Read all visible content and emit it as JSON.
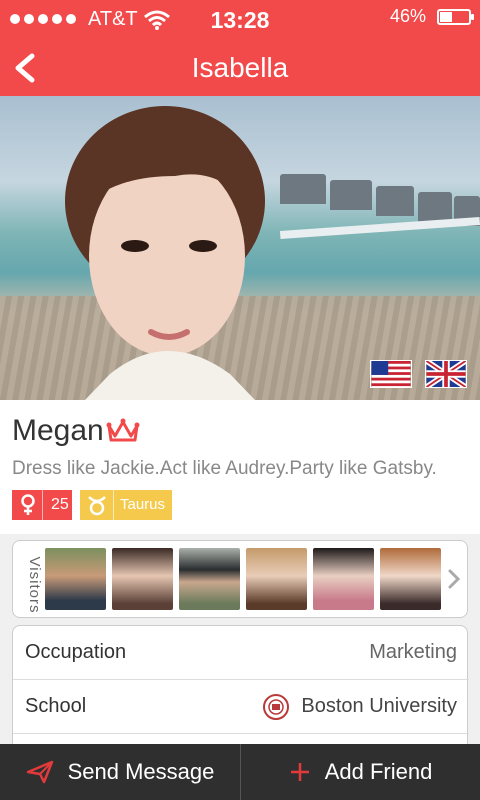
{
  "status_bar": {
    "carrier": "AT&T",
    "time": "13:28",
    "battery": "46%"
  },
  "nav": {
    "title": "Isabella",
    "back_icon": "chevron-left-icon"
  },
  "photo": {
    "flags": [
      "us-flag",
      "uk-flag"
    ]
  },
  "profile": {
    "name": "Megan",
    "crown_icon": "crown-icon",
    "bio": "Dress like Jackie.Act like Audrey.Party like Gatsby.",
    "age": "25",
    "zodiac": "Taurus"
  },
  "visitors": {
    "label": "Visitors",
    "count": 6
  },
  "details": {
    "occupation_label": "Occupation",
    "occupation_value": "Marketing",
    "school_label": "School",
    "school_value": "Boston University"
  },
  "actions": {
    "send_message": "Send Message",
    "add_friend": "Add Friend"
  },
  "colors": {
    "accent": "#f24a4a",
    "zodiac": "#f5c94b",
    "bottom_bar": "#2f2f2f"
  }
}
